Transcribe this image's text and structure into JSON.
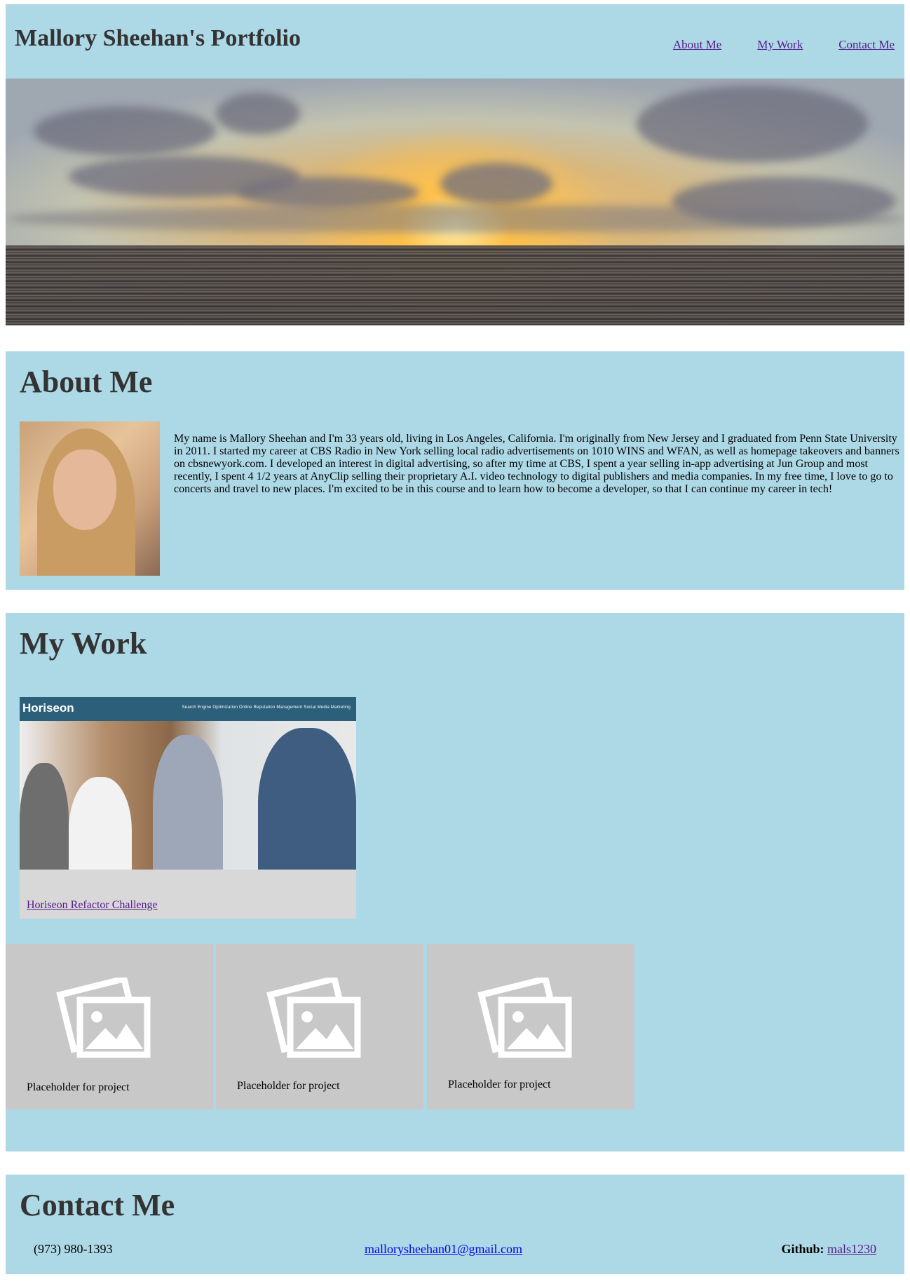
{
  "header": {
    "title": "Mallory Sheehan's Portfolio",
    "nav": [
      "About Me",
      "My Work",
      "Contact Me"
    ]
  },
  "about": {
    "heading": "About Me",
    "bio": "My name is Mallory Sheehan and I'm 33 years old, living in Los Angeles, California. I'm originally from New Jersey and I graduated from Penn State University in 2011. I started my career at CBS Radio in New York selling local radio advertisements on 1010 WINS and WFAN, as well as homepage takeovers and banners on cbsnewyork.com. I developed an interest in digital advertising, so after my time at CBS, I spent a year selling in-app advertising at Jun Group and most recently, I spent 4 1/2 years at AnyClip selling their proprietary A.I. video technology to digital publishers and media companies. In my free time, I love to go to concerts and travel to new places. I'm excited to be in this course and to learn how to become a developer, so that I can continue my career in tech!"
  },
  "work": {
    "heading": "My Work",
    "featured": {
      "brand": "Horiseon",
      "menu": "Search Engine Optimization    Online Reputation Management    Social Media Marketing",
      "link": "Horiseon Refactor Challenge"
    },
    "placeholders": [
      {
        "label": "Placeholder for project",
        "icon": "image-placeholder-icon"
      },
      {
        "label": "Placeholder for project",
        "icon": "image-placeholder-icon"
      },
      {
        "label": "Placeholder for project",
        "icon": "image-placeholder-icon"
      }
    ]
  },
  "contact": {
    "heading": "Contact Me",
    "phone": "(973) 980-1393",
    "email": "mallorysheehan01@gmail.com",
    "github_label": "Github:",
    "github_user": "mals1230"
  },
  "colors": {
    "panel_bg": "#add8e6",
    "heading_text": "#333333",
    "visited_link": "#551a8b",
    "link": "#0000ee",
    "placeholder_bg": "#c8c8c8"
  }
}
